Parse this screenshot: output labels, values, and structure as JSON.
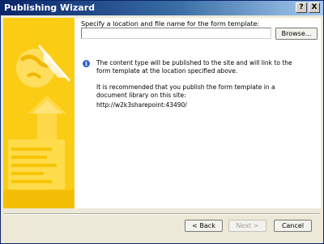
{
  "window": {
    "title": "Publishing Wizard",
    "help_glyph": "?",
    "close_glyph": "X"
  },
  "form": {
    "prompt": "Specify a location and file name for the form template:",
    "path_value": "",
    "browse_label": "Browse..."
  },
  "info": {
    "icon": "info-icon",
    "text": "The content type will be published to the site and will link to the form template at the location specified above.",
    "recommend": "It is recommended that you publish the form template in a document library on this site:",
    "site_url": "http://w2k3sharepoint:43490/"
  },
  "buttons": {
    "back": "< Back",
    "next": "Next >",
    "cancel": "Cancel"
  },
  "colors": {
    "titlebar_start": "#0a246a",
    "art_yellow": "#f5c300",
    "info_blue": "#2f63c7"
  }
}
